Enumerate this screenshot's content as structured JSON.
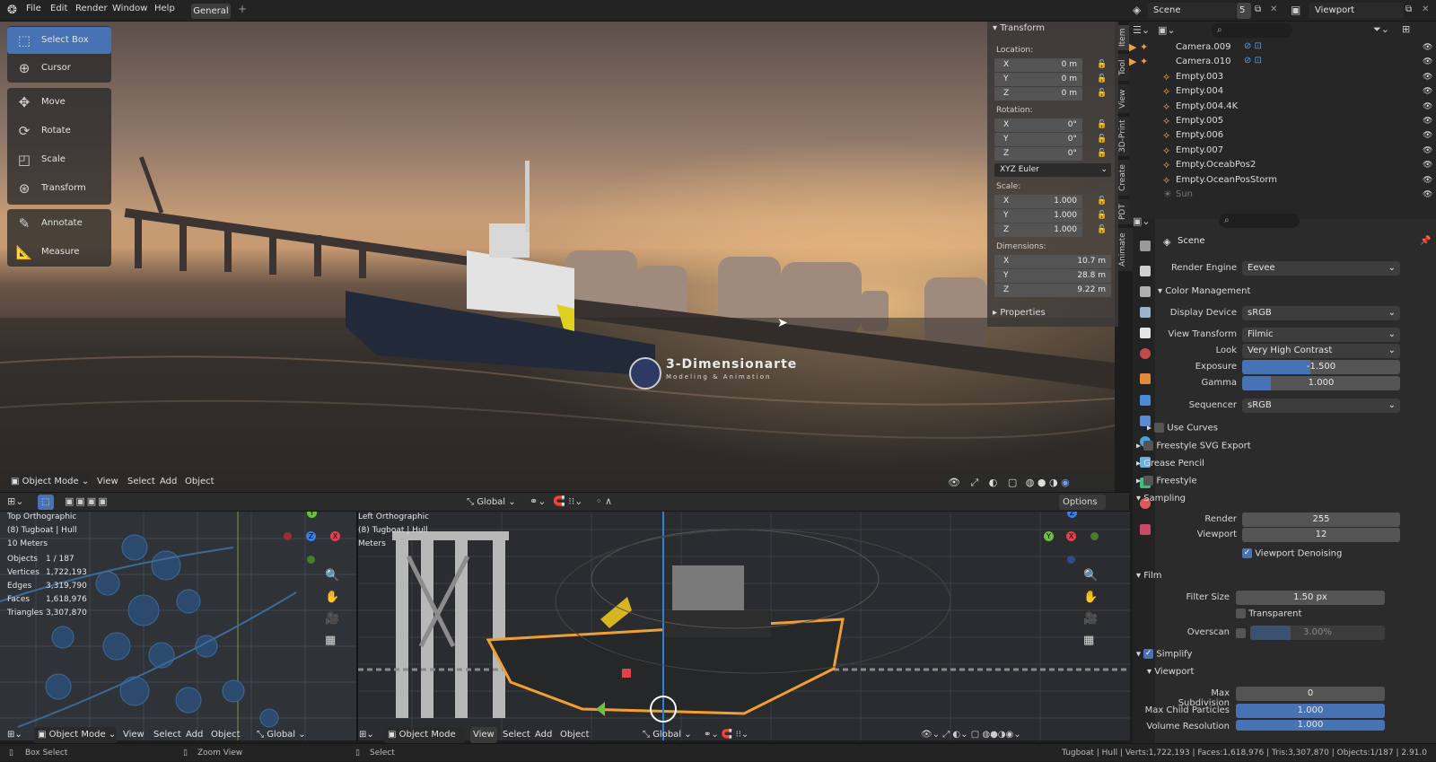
{
  "menubar": {
    "items": [
      "File",
      "Edit",
      "Render",
      "Window",
      "Help"
    ],
    "workspace_tab": "General",
    "add_tab": "+"
  },
  "topright": {
    "scene_label": "Scene",
    "scene_count": "5",
    "viewlayer_label": "Viewport"
  },
  "viewport": {
    "mode": "Object Mode",
    "menu": [
      "View",
      "Select",
      "Add",
      "Object"
    ],
    "watermark_title": "3-Dimensionarte",
    "watermark_sub": "Modeling & Animation"
  },
  "tools": [
    {
      "label": "Select Box",
      "icon": "select-box-icon",
      "active": true
    },
    {
      "label": "Cursor",
      "icon": "cursor-icon"
    },
    {
      "label": "Move",
      "icon": "move-icon"
    },
    {
      "label": "Rotate",
      "icon": "rotate-icon"
    },
    {
      "label": "Scale",
      "icon": "scale-icon"
    },
    {
      "label": "Transform",
      "icon": "transform-icon"
    },
    {
      "label": "Annotate",
      "icon": "annotate-icon"
    },
    {
      "label": "Measure",
      "icon": "measure-icon"
    }
  ],
  "npanel": {
    "title": "Transform",
    "location_label": "Location:",
    "location": [
      {
        "ax": "X",
        "val": "0 m"
      },
      {
        "ax": "Y",
        "val": "0 m"
      },
      {
        "ax": "Z",
        "val": "0 m"
      }
    ],
    "rotation_label": "Rotation:",
    "rotation": [
      {
        "ax": "X",
        "val": "0°"
      },
      {
        "ax": "Y",
        "val": "0°"
      },
      {
        "ax": "Z",
        "val": "0°"
      }
    ],
    "rotation_mode": "XYZ Euler",
    "scale_label": "Scale:",
    "scale": [
      {
        "ax": "X",
        "val": "1.000"
      },
      {
        "ax": "Y",
        "val": "1.000"
      },
      {
        "ax": "Z",
        "val": "1.000"
      }
    ],
    "dimensions_label": "Dimensions:",
    "dimensions": [
      {
        "ax": "X",
        "val": "10.7 m"
      },
      {
        "ax": "Y",
        "val": "28.8 m"
      },
      {
        "ax": "Z",
        "val": "9.22 m"
      }
    ],
    "properties": "Properties",
    "tabs": [
      "Item",
      "Tool",
      "View",
      "3D-Print",
      "Create",
      "PDT",
      "Animate"
    ]
  },
  "midbar": {
    "orientation": "Global",
    "options": "Options"
  },
  "topview": {
    "title": "Top Orthographic",
    "object": "(8) Tugboat | Hull",
    "scale": "10 Meters",
    "stats": [
      {
        "k": "Objects",
        "v": "1 / 187"
      },
      {
        "k": "Vertices",
        "v": "1,722,193"
      },
      {
        "k": "Edges",
        "v": "3,319,790"
      },
      {
        "k": "Faces",
        "v": "1,618,976"
      },
      {
        "k": "Triangles",
        "v": "3,307,870"
      }
    ]
  },
  "sideview": {
    "title": "Left Orthographic",
    "object": "(8) Tugboat | Hull",
    "scale": "Meters"
  },
  "bottomhdr_left": {
    "mode": "Object Mode",
    "menu": [
      "View",
      "Select",
      "Add",
      "Object"
    ],
    "orientation": "Global"
  },
  "bottomhdr_right": {
    "mode": "Object Mode",
    "menu": [
      "View",
      "Select",
      "Add",
      "Object"
    ],
    "orientation": "Global"
  },
  "statusbar": {
    "left": "Box Select",
    "mid": "Zoom View",
    "select": "Select",
    "right": "Tugboat | Hull | Verts:1,722,193 | Faces:1,618,976 | Tris:3,307,870 | Objects:1/187 | 2.91.0"
  },
  "outliner": {
    "items": [
      {
        "name": "Camera.009",
        "type": "camera"
      },
      {
        "name": "Camera.010",
        "type": "camera"
      },
      {
        "name": "Empty.003",
        "type": "empty"
      },
      {
        "name": "Empty.004",
        "type": "empty"
      },
      {
        "name": "Empty.004.4K",
        "type": "empty"
      },
      {
        "name": "Empty.005",
        "type": "empty"
      },
      {
        "name": "Empty.006",
        "type": "empty"
      },
      {
        "name": "Empty.007",
        "type": "empty"
      },
      {
        "name": "Empty.OceabPos2",
        "type": "empty"
      },
      {
        "name": "Empty.OceanPosStorm",
        "type": "empty"
      },
      {
        "name": "Sun",
        "type": "light"
      }
    ]
  },
  "properties": {
    "context": "Scene",
    "render_engine_label": "Render Engine",
    "render_engine": "Eevee",
    "color_mgmt": "Color Management",
    "display_device_label": "Display Device",
    "display_device": "sRGB",
    "view_transform_label": "View Transform",
    "view_transform": "Filmic",
    "look_label": "Look",
    "look": "Very High Contrast",
    "exposure_label": "Exposure",
    "exposure": "-1.500",
    "exposure_fill": 0.43,
    "gamma_label": "Gamma",
    "gamma": "1.000",
    "gamma_fill": 0.18,
    "sequencer_label": "Sequencer",
    "sequencer": "sRGB",
    "use_curves": "Use Curves",
    "freestyle_svg": "Freestyle SVG Export",
    "grease_pencil": "Grease Pencil",
    "freestyle": "Freestyle",
    "sampling": "Sampling",
    "render_label": "Render",
    "render": "255",
    "viewport_label": "Viewport",
    "viewport": "12",
    "viewport_denoising": "Viewport Denoising",
    "film": "Film",
    "filter_size_label": "Filter Size",
    "filter_size": "1.50 px",
    "transparent": "Transparent",
    "overscan_label": "Overscan",
    "overscan": "3.00%",
    "simplify": "Simplify",
    "simplify_viewport": "Viewport",
    "max_subdiv_label": "Max Subdivision",
    "max_subdiv": "0",
    "max_child_label": "Max Child Particles",
    "max_child": "1.000",
    "volume_res_label": "Volume Resolution",
    "volume_res": "1.000"
  },
  "colors": {
    "accent": "#4772b3",
    "empty_icon": "#e8a24f"
  }
}
